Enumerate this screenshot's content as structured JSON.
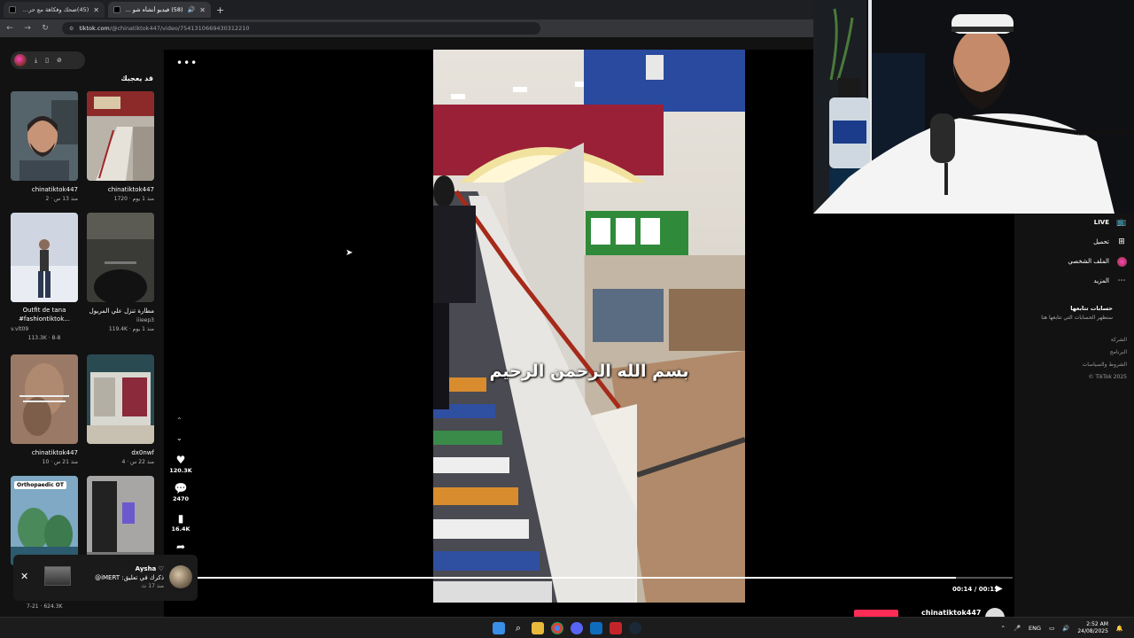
{
  "browser": {
    "tabs": [
      {
        "label": "(45)ضحك وفكاهة مع حركات الب...",
        "active": false
      },
      {
        "label": "(58) فيديو أنشأه شو بدك من",
        "active": true
      }
    ],
    "url_host": "tiktok.com",
    "url_path": "/@chinatiktok447/video/7541310669430312210",
    "new_tab": "+"
  },
  "left": {
    "section_title": "قد يعجبك",
    "cards": [
      {
        "title": "chinatiktok447",
        "meta": "2 · منذ 13 س",
        "type": "user"
      },
      {
        "title": "chinatiktok447",
        "meta": "1720 · منذ 1 يوم",
        "type": "user"
      },
      {
        "title": "Outfit de tana #fashiontiktok...",
        "subtitle": "v.vlt09",
        "meta": "113.3K · 8-8",
        "type": "text"
      },
      {
        "title": "مطارة تنزل علي المريول",
        "subtitle": "iiieep3",
        "meta": "119.4K · منذ 1 يوم",
        "type": "text"
      },
      {
        "title": "chinatiktok447",
        "meta": "10 · منذ 21 س",
        "type": "user"
      },
      {
        "title": "dx0nwf",
        "meta": "4 · منذ 22 س",
        "type": "user"
      },
      {
        "title": "",
        "meta": "",
        "type": "none"
      },
      {
        "title": "",
        "meta": "",
        "type": "none"
      }
    ],
    "bottom_meta": "7-21 · 624.3K",
    "ortho_badge": "Orthopaedic OT"
  },
  "video": {
    "caption": "بسم الله الرحمن الرحيم",
    "more_label": "•••",
    "likes": "120.3K",
    "comments": "2470",
    "saves": "16.4K",
    "time": "00:14 / 00:15",
    "progress": 0.93
  },
  "toast": {
    "name": "Aysha ♡",
    "message": "ذكرك في تعليق: iMERT@",
    "time": "منذ 17 ث",
    "close": "✕"
  },
  "right": {
    "nav": [
      {
        "label": "LIVE",
        "icon": "live-icon"
      },
      {
        "label": "تحميل",
        "icon": "upload-icon"
      },
      {
        "label": "الملف الشخصي",
        "icon": "profile-icon"
      },
      {
        "label": "المزيد",
        "icon": "more-icon"
      }
    ],
    "following_title": "حسابات تتابعها",
    "following_sub": "ستظهر الحسابات التي تتابعها هنا",
    "links": [
      "الشركة",
      "البرنامج",
      "الشروط والسياسات",
      "© TikTok 2025"
    ],
    "author": "chinatiktok447"
  },
  "taskbar": {
    "lang": "ENG",
    "time": "2:52 AM",
    "date": "24/08/2025"
  },
  "colors": {
    "accent": "#fe2c55",
    "page_bg": "#121212"
  }
}
